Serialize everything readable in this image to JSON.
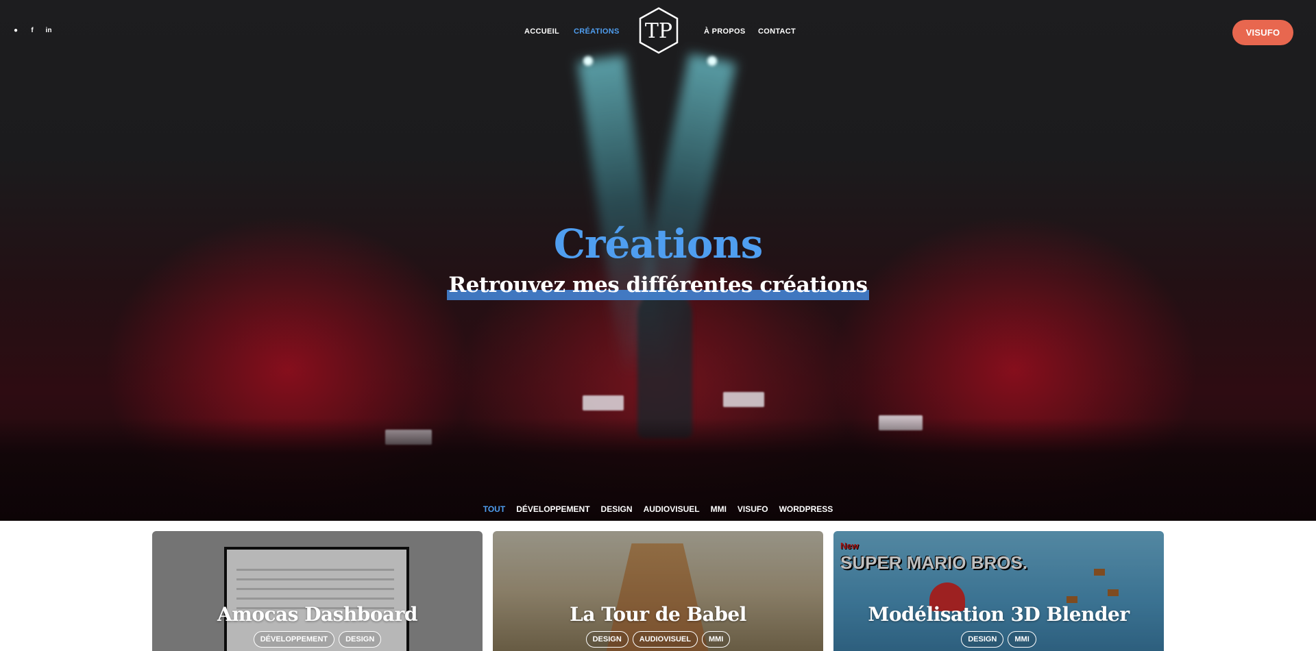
{
  "nav": {
    "socials": [
      {
        "icon": "github-icon",
        "glyph": "●"
      },
      {
        "icon": "facebook-icon",
        "glyph": "f"
      },
      {
        "icon": "linkedin-icon",
        "glyph": "in"
      }
    ],
    "links": {
      "accueil": "ACCUEIL",
      "creations": "CRÉATIONS",
      "apropos": "À PROPOS",
      "contact": "CONTACT"
    },
    "logo_text": "TP",
    "cta": "VISUFO"
  },
  "hero": {
    "title": "Créations",
    "subtitle": "Retrouvez mes différentes créations"
  },
  "filters": [
    "TOUT",
    "DÉVELOPPEMENT",
    "DESIGN",
    "AUDIOVISUEL",
    "MMI",
    "VISUFO",
    "WORDPRESS"
  ],
  "active_filter": "TOUT",
  "cards": [
    {
      "title": "Amocas Dashboard",
      "tags": [
        "DÉVELOPPEMENT",
        "DESIGN"
      ]
    },
    {
      "title": "La Tour de Babel",
      "tags": [
        "DESIGN",
        "AUDIOVISUEL",
        "MMI"
      ]
    },
    {
      "title": "Modélisation 3D Blender",
      "tags": [
        "DESIGN",
        "MMI"
      ],
      "image_brand": {
        "new": "New",
        "name": "SUPER MARIO BROS."
      }
    }
  ],
  "colors": {
    "accent": "#4f9ef0",
    "cta": "#e8674f",
    "hero_bg": "#1d1d1f"
  }
}
